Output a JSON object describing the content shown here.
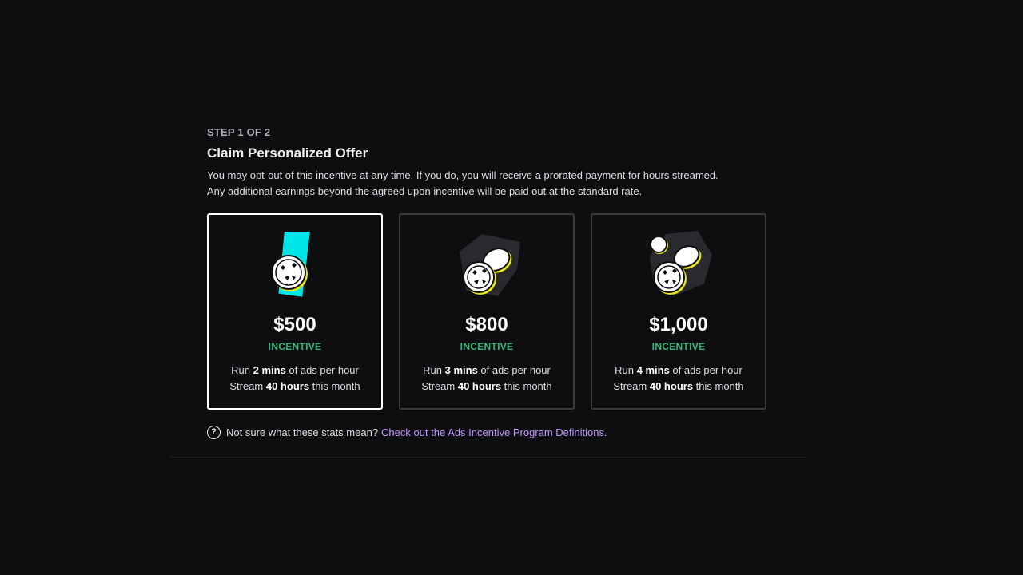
{
  "step": "STEP 1 OF 2",
  "title": "Claim Personalized Offer",
  "description_line1": "You may opt-out of this incentive at any time. If you do, you will receive a prorated payment for hours streamed.",
  "description_line2": "Any additional earnings beyond the agreed upon incentive will be paid out at the standard rate.",
  "cards": [
    {
      "amount": "$500",
      "badge": "INCENTIVE",
      "run_prefix": "Run ",
      "run_value": "2 mins",
      "run_suffix": " of ads per hour",
      "stream_prefix": "Stream ",
      "stream_value": "40 hours",
      "stream_suffix": " this month",
      "selected": true,
      "icon": "coin-cyan-card-icon"
    },
    {
      "amount": "$800",
      "badge": "INCENTIVE",
      "run_prefix": "Run ",
      "run_value": "3 mins",
      "run_suffix": " of ads per hour",
      "stream_prefix": "Stream ",
      "stream_value": "40 hours",
      "stream_suffix": " this month",
      "selected": false,
      "icon": "two-coins-icon"
    },
    {
      "amount": "$1,000",
      "badge": "INCENTIVE",
      "run_prefix": "Run ",
      "run_value": "4 mins",
      "run_suffix": " of ads per hour",
      "stream_prefix": "Stream ",
      "stream_value": "40 hours",
      "stream_suffix": " this month",
      "selected": false,
      "icon": "three-coins-icon"
    }
  ],
  "footer": {
    "text": "Not sure what these stats mean?",
    "link": "Check out the Ads Incentive Program Definitions."
  },
  "colors": {
    "background": "#0e0e10",
    "accent_green": "#34b67a",
    "link_purple": "#bf94ff",
    "cyan": "#00e5e5"
  }
}
